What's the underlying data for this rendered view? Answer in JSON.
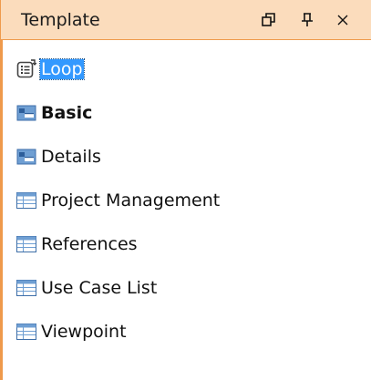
{
  "panel": {
    "title": "Template",
    "buttons": [
      {
        "icon": "restore-window-icon"
      },
      {
        "icon": "pin-icon"
      },
      {
        "icon": "close-icon"
      }
    ]
  },
  "items": [
    {
      "label": "Loop",
      "icon": "loop-icon",
      "selected": true,
      "bold": false
    },
    {
      "label": "Basic",
      "icon": "form-template-icon",
      "selected": false,
      "bold": true
    },
    {
      "label": "Details",
      "icon": "form-template-icon",
      "selected": false,
      "bold": false
    },
    {
      "label": "Project Management",
      "icon": "table-template-icon",
      "selected": false,
      "bold": false
    },
    {
      "label": "References",
      "icon": "table-template-icon",
      "selected": false,
      "bold": false
    },
    {
      "label": "Use Case List",
      "icon": "table-template-icon",
      "selected": false,
      "bold": false
    },
    {
      "label": "Viewpoint",
      "icon": "table-template-icon",
      "selected": false,
      "bold": false
    }
  ],
  "colors": {
    "titlebar_bg": "#fbdcbc",
    "accent_border": "#ef9a4c",
    "selection": "#3399ff"
  }
}
